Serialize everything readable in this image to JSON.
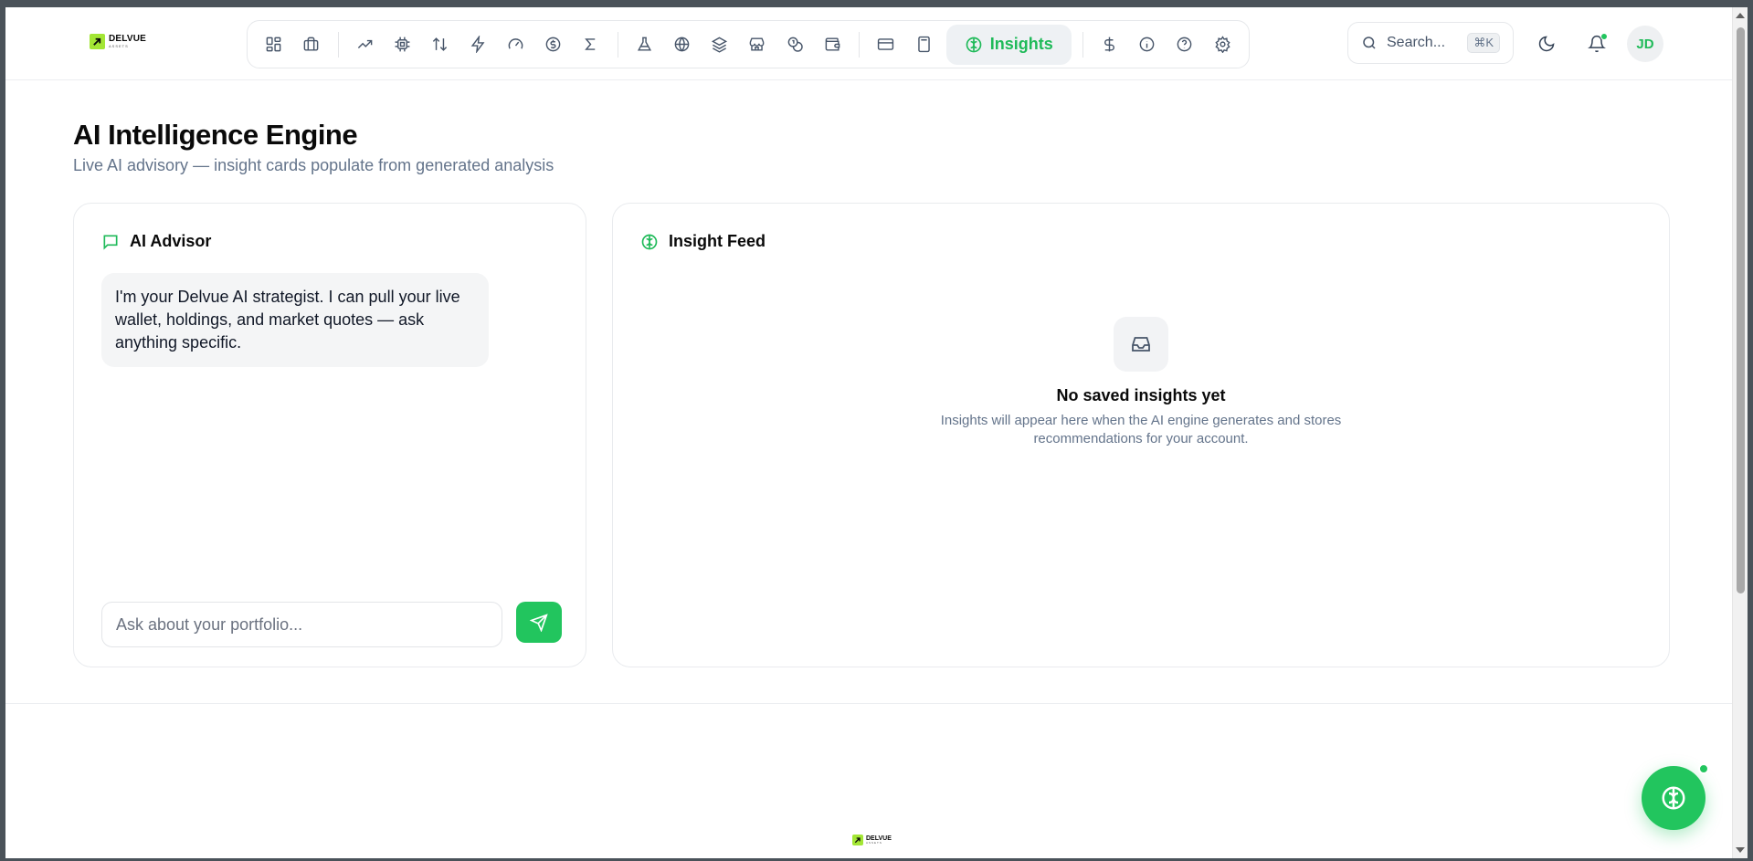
{
  "brand": {
    "name": "DELVUE",
    "tagline": "ASSETS",
    "accent": "#22c55e",
    "logo_color": "#a3e635"
  },
  "nav": {
    "items": [
      {
        "icon": "dashboard-grid-icon"
      },
      {
        "icon": "briefcase-icon"
      },
      {
        "icon": "trending-up-icon"
      },
      {
        "icon": "cpu-chip-icon"
      },
      {
        "icon": "arrows-up-down-icon"
      },
      {
        "icon": "lightning-bolt-icon"
      },
      {
        "icon": "gauge-icon"
      },
      {
        "icon": "dollar-circle-icon"
      },
      {
        "icon": "sigma-icon"
      },
      {
        "icon": "flask-icon"
      },
      {
        "icon": "globe-icon"
      },
      {
        "icon": "layers-icon"
      },
      {
        "icon": "store-icon"
      },
      {
        "icon": "coins-icon"
      },
      {
        "icon": "wallet-icon"
      },
      {
        "icon": "credit-card-icon"
      },
      {
        "icon": "calculator-icon"
      },
      {
        "icon": "brain-icon",
        "label": "Insights",
        "active": true
      },
      {
        "icon": "dollar-sign-icon"
      },
      {
        "icon": "info-icon"
      },
      {
        "icon": "help-circle-icon"
      },
      {
        "icon": "settings-gear-icon"
      }
    ],
    "active_label": "Insights"
  },
  "search": {
    "placeholder": "Search...",
    "shortcut": "⌘K"
  },
  "user": {
    "initials": "JD"
  },
  "page": {
    "title": "AI Intelligence Engine",
    "subtitle": "Live AI advisory — insight cards populate from generated analysis"
  },
  "advisor": {
    "title": "AI Advisor",
    "message": "I'm your Delvue AI strategist. I can pull your live wallet, holdings, and market quotes — ask anything specific.",
    "input_placeholder": "Ask about your portfolio..."
  },
  "feed": {
    "title": "Insight Feed",
    "empty_title": "No saved insights yet",
    "empty_description": "Insights will appear here when the AI engine generates and stores recommendations for your account."
  }
}
